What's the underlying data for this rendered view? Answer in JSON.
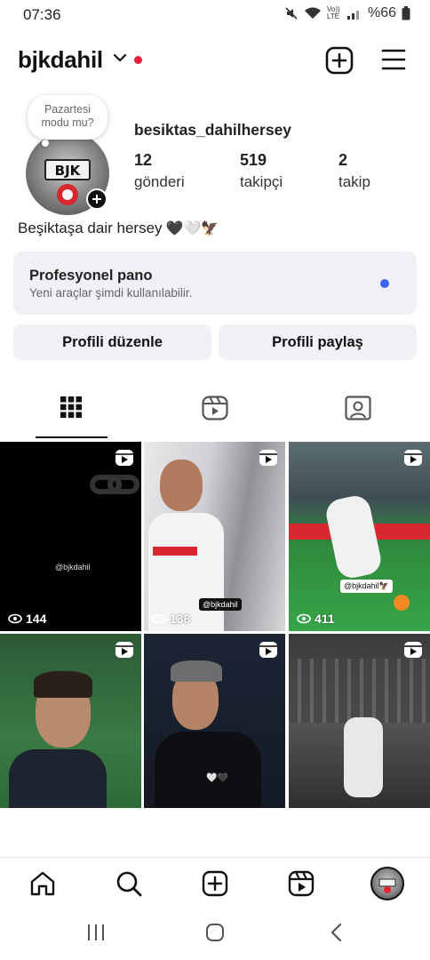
{
  "status_bar": {
    "time": "07:36",
    "battery": "%66",
    "volte": "Vo)) LTE"
  },
  "header": {
    "username": "bjkdahil"
  },
  "note": {
    "line1": "Pazartesi",
    "line2": "modu mu?"
  },
  "profile": {
    "handle": "besiktas_dahilhersey",
    "stats": [
      {
        "value": "12",
        "label": "gönderi"
      },
      {
        "value": "519",
        "label": "takipçi"
      },
      {
        "value": "2",
        "label": "takip"
      }
    ],
    "bio": "Beşiktaşa dair hersey",
    "bio_emojis": "🖤🤍🦅"
  },
  "pro_panel": {
    "title": "Profesyonel pano",
    "subtitle": "Yeni araçlar şimdi kullanılabilir."
  },
  "buttons": {
    "edit": "Profili düzenle",
    "share": "Profili paylaş"
  },
  "tabs": [
    {
      "icon": "grid-icon",
      "active": true
    },
    {
      "icon": "reels-icon",
      "active": false
    },
    {
      "icon": "tagged-icon",
      "active": false
    }
  ],
  "posts": [
    {
      "views": "144",
      "watermark": "@bjkdahil"
    },
    {
      "views": "138",
      "watermark": "@bjkdahil"
    },
    {
      "views": "411",
      "watermark": "@bjkdahil🦅"
    },
    {
      "views": "",
      "watermark": ""
    },
    {
      "views": "",
      "watermark": ""
    },
    {
      "views": "",
      "watermark": ""
    }
  ],
  "colors": {
    "accent_red": "#ee1d3b",
    "notification_blue": "#3f63f0",
    "panel_bg": "#eff1f5"
  }
}
